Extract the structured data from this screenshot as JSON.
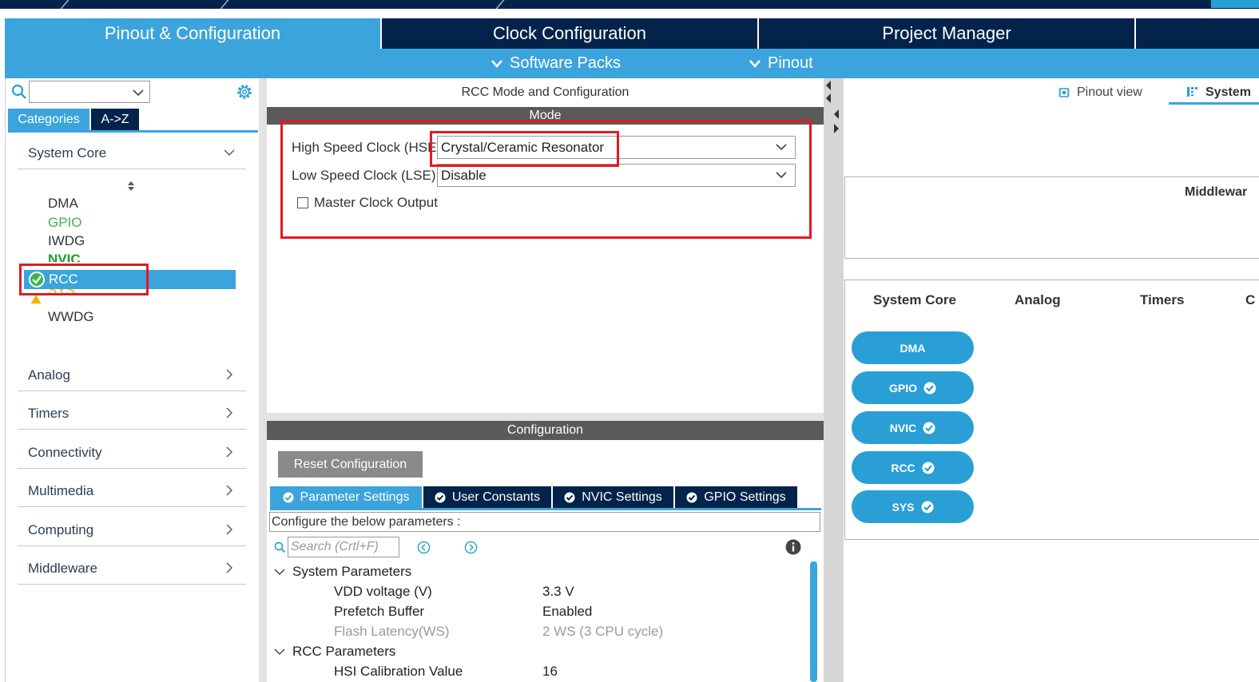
{
  "main_tabs": [
    {
      "label": "Pinout & Configuration",
      "active": true
    },
    {
      "label": "Clock Configuration",
      "active": false
    },
    {
      "label": "Project Manager",
      "active": false
    }
  ],
  "sub_menu": {
    "software_packs": "Software Packs",
    "pinout": "Pinout"
  },
  "left": {
    "category_tabs": [
      "Categories",
      "A->Z"
    ],
    "categories": {
      "system_core": "System Core",
      "analog": "Analog",
      "timers": "Timers",
      "connectivity": "Connectivity",
      "multimedia": "Multimedia",
      "computing": "Computing",
      "middleware": "Middleware"
    },
    "system_core_items": [
      {
        "label": "DMA",
        "color": "#333333"
      },
      {
        "label": "GPIO",
        "color": "#3cb44b"
      },
      {
        "label": "IWDG",
        "color": "#333333"
      },
      {
        "label": "NVIC",
        "color": "#1e9c2a"
      },
      {
        "label": "RCC",
        "color": "#ffffff"
      },
      {
        "label": "SYS",
        "color": "#e8b400"
      },
      {
        "label": "WWDG",
        "color": "#333333"
      }
    ]
  },
  "mode": {
    "title": "RCC Mode and Configuration",
    "section": "Mode",
    "hse_label": "High Speed Clock (HSE)",
    "hse_value": "Crystal/Ceramic Resonator",
    "lse_label": "Low Speed Clock (LSE)",
    "lse_value": "Disable",
    "mco_label": "Master Clock Output"
  },
  "configuration": {
    "section": "Configuration",
    "reset_button": "Reset Configuration",
    "tabs": [
      "Parameter Settings",
      "User Constants",
      "NVIC Settings",
      "GPIO Settings"
    ],
    "hint": "Configure the below parameters :",
    "search_placeholder": "Search (Crtl+F)",
    "groups": [
      {
        "name": "System Parameters",
        "params": [
          {
            "name": "VDD voltage (V)",
            "value": "3.3 V",
            "disabled": false
          },
          {
            "name": "Prefetch Buffer",
            "value": "Enabled",
            "disabled": false
          },
          {
            "name": "Flash Latency(WS)",
            "value": "2 WS (3 CPU cycle)",
            "disabled": true
          }
        ]
      },
      {
        "name": "RCC Parameters",
        "params": [
          {
            "name": "HSI Calibration Value",
            "value": "16",
            "disabled": false
          }
        ]
      }
    ]
  },
  "right": {
    "pinout_view": "Pinout view",
    "system_view": "System",
    "middleware_label": "Middlewar",
    "columns": [
      "System Core",
      "Analog",
      "Timers",
      "C"
    ],
    "pills": [
      {
        "label": "DMA",
        "checked": false
      },
      {
        "label": "GPIO",
        "checked": true
      },
      {
        "label": "NVIC",
        "checked": true
      },
      {
        "label": "RCC",
        "checked": true
      },
      {
        "label": "SYS",
        "checked": true
      }
    ]
  },
  "colors": {
    "navy": "#03234b",
    "accent_blue": "#3ca4dc",
    "highlight_red": "#e11b22",
    "check_green": "#3cb44b",
    "warning_yellow": "#e8b400"
  }
}
